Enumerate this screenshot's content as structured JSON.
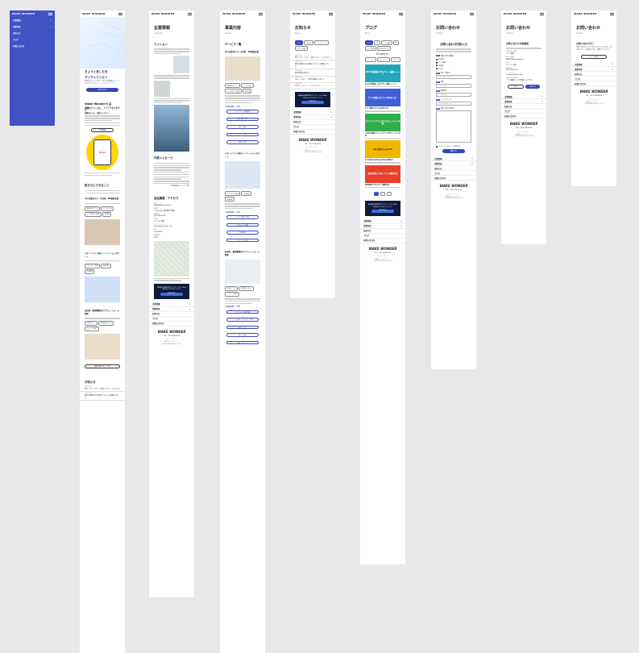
{
  "brand": {
    "logo": "WAKE WONDER",
    "tel": "TEL：03-1234-5678",
    "privacy": "プライバシーポリシー",
    "security": "情報セキュリティポリシー",
    "copyright": "©2024 Wake Wonder Co.,Ltd."
  },
  "footer_nav": [
    "企業情報",
    "事業内容",
    "お知らせ",
    "ブログ",
    "お問い合わせ"
  ],
  "menu_screen": {
    "items": [
      "企業情報",
      "事業内容",
      "お知らせ",
      "ブログ",
      "お問い合わせ"
    ]
  },
  "top": {
    "hero_line1": "きょうとあしたを",
    "hero_line2": "デジタルでつなぐ",
    "hero_desc": "現場からアイデアまで、あなたの業務をスマートにするモバイルソリューションパートナー",
    "hero_cta": "お問い合わせ",
    "about_title": "Wake Wonderとは",
    "about_lead": "課題をチャンスに、アイデアをカタチに",
    "about_lead2": "技術をもっと、身近にしていく",
    "about_btn": "企業情報",
    "services_title": "私たちにできること",
    "svc1": "中小企業向けデータ活用・DX推進支援",
    "svc2": "スタートアップ向けイノベーションサポート",
    "svc3": "自治体・教育機関向けプラットフォーム開発",
    "svc_btn": "事業内容を詳しく見る",
    "news_title": "お知らせ",
    "oha": "Oha!"
  },
  "company": {
    "title": "企業情報",
    "sub": "Company",
    "mission_h": "ミッション",
    "message_h": "代表メッセージ",
    "ceo": "代表取締役 ボイトク 太郎",
    "access_h": "会社概要・アクセス",
    "kv": [
      {
        "k": "社名",
        "v": "株式会社Wake Wonder"
      },
      {
        "k": "所在地",
        "v": "〒100-0001 東京都千代田区"
      },
      {
        "k": "電話番号",
        "v": "03-1234-5678"
      },
      {
        "k": "代表者",
        "v": "ボイトク 太郎"
      },
      {
        "k": "メールアドレス",
        "v": "info@wakewonder.com"
      },
      {
        "k": "設立",
        "v": "2024年4月"
      },
      {
        "k": "従業員数",
        "v": "15名"
      }
    ],
    "banner": "自社開発 業務効率化アプリケーション Wake Wonderにおまかせください",
    "banner_btn": "お問い合わせ"
  },
  "business": {
    "title": "事業内容",
    "sub": "Service",
    "overview_h": "サービス一覧",
    "s1": "中小企業向けデータ活用・DX推進支援",
    "s2": "スタートアップ向けイノベーションサポート",
    "s3": "自治体・教育機関向けプラットフォーム開発",
    "tags1": [
      "業務効率化アプリ",
      "クラウド移行",
      "データ分析・可視化",
      "DX研修"
    ],
    "tags2": [
      "プロトタイプ開発",
      "MVP開発",
      "技術顧問"
    ],
    "tags3": [
      "自治体アプリ",
      "学習管理システム",
      "オンライン申請"
    ],
    "cases": "ご支援の流れ（一例）",
    "steps": [
      "ヒアリング・課題整理",
      "要件定義・提案",
      "設計・開発",
      "テスト・検証",
      "運用・保守"
    ],
    "steps2": [
      "アイデア整理・検証",
      "プロトタイプ開発",
      "MVP開発",
      "リリース・改善"
    ],
    "steps3": [
      "ヒアリング・要件定義",
      "システム設計・プロトタイプ作成",
      "開発・テスト",
      "導入・研修",
      "運用・サポート"
    ]
  },
  "news": {
    "title": "お知らせ",
    "sub": "News",
    "tabs": [
      "すべて",
      "お知らせ",
      "プレスリリース",
      "セミナー情報"
    ],
    "items": [
      {
        "date": "2024.09.20",
        "title": "新サービス「スマート受付」をリリースしました"
      },
      {
        "date": "2024.09.01",
        "title": "都内企業様向けDX推進プログラムを開始しました"
      },
      {
        "date": "2024.08.15",
        "title": "夏季休業のお知らせ"
      },
      {
        "date": "2024.07.10",
        "title": "CEOインタビュー記事が掲載されました"
      },
      {
        "date": "2024.06.01",
        "title": "公式サイトをリニューアルしました"
      }
    ],
    "banner": "自社開発 業務効率化アプリケーション Wake Wonderにおまかせください",
    "banner_btn": "お問い合わせ"
  },
  "blog": {
    "title": "ブログ",
    "sub": "Blog",
    "tabs": [
      "すべて",
      "DX",
      "アプリ開発",
      "AI",
      "データ活用",
      "UI/UXデザイン",
      "ノーコード",
      "セキュリティ",
      "クラウド"
    ],
    "cat_h": "おすすめカテゴリ",
    "cards": [
      {
        "thumb": "2024年最新版 DXデザイン最新トレンド",
        "title": "2024年最新版：DXデザイン最新トレンド",
        "color": "#21a7b8"
      },
      {
        "thumb": "アプリ開発における AI活用とは？",
        "title": "アプリ開発におけるAI活用とは？",
        "color": "#3f5fd8"
      },
      {
        "thumb": "モバイルアプリにおけるセキュリティ対策",
        "title": "【大切な情報】モバイルアプリのセキュリティ対策",
        "color": "#2fae4c"
      },
      {
        "thumb": "中小企業のための DX",
        "title": "中小企業のための2024年DXの始め方",
        "color": "#f2b600"
      },
      {
        "thumb": "成功事例から学ぶ アプリ開発手法",
        "title": "成功事例から学ぶアプリ開発手法",
        "color": "#e8402a"
      }
    ],
    "pager": [
      "1",
      "2",
      "›"
    ]
  },
  "contact": {
    "title": "お問い合わせ",
    "sub": "Contact",
    "form_h": "お問い合わせ内容入力",
    "types_label": "お問い合わせ種別",
    "types": [
      "資料請求",
      "アプリ開発",
      "DX支援",
      "その他"
    ],
    "fields": [
      {
        "label": "会社・団体名",
        "ph": "株式会社Wake Wonder"
      },
      {
        "label": "氏名",
        "ph": "ウェイク 太郎"
      },
      {
        "label": "電話番号",
        "ph": "03-1234-5678"
      },
      {
        "label": "メールアドレス",
        "ph": "example@wake.com"
      }
    ],
    "message_label": "お問い合わせ内容",
    "agree": "プライバシーポリシーに同意する",
    "submit": "確認する",
    "req": "必須"
  },
  "confirm": {
    "title": "お問い合わせ",
    "sub": "Contact",
    "form_h": "お問い合わせ内容確認",
    "kv": [
      {
        "k": "お問い合わせ種別",
        "v": "アプリ開発"
      },
      {
        "k": "会社・団体名",
        "v": "株式会社Wake Wonder"
      },
      {
        "k": "氏名",
        "v": "ウェイク 太郎"
      },
      {
        "k": "電話番号",
        "v": "03-1234-5678"
      },
      {
        "k": "メールアドレス",
        "v": "example@wake.com"
      },
      {
        "k": "お問い合わせ内容",
        "v": "アプリ開発について相談したいです。"
      }
    ],
    "back": "戻る",
    "send": "送信する"
  },
  "thanks": {
    "title": "お問い合わせ",
    "sub": "Contact",
    "done_h": "お問い合わせ完了",
    "msg": "お問い合わせいただきありがとうございます。担当者より2〜3営業日以内にご連絡いたします。",
    "top_btn": "トップに戻る"
  }
}
